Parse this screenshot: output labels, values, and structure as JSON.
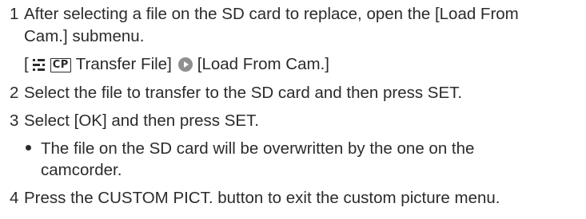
{
  "steps": [
    {
      "number": "1",
      "line1": "After selecting a file on the SD card to replace, open the [Load From",
      "line2": "Cam.] submenu.",
      "menu_path": {
        "open_bracket": "[",
        "menu_icon": "menu-lines-icon",
        "cp_label": "CP",
        "item": "Transfer File]",
        "arrow_icon": "right-arrow-circle-icon",
        "target": "[Load From Cam.]"
      }
    },
    {
      "number": "2",
      "text": "Select the file to transfer to the SD card and then press SET."
    },
    {
      "number": "3",
      "text": "Select [OK] and then press SET.",
      "bullet": {
        "line1": "The file on the SD card will be overwritten by the one on the",
        "line2": "camcorder."
      }
    },
    {
      "number": "4",
      "text": "Press the CUSTOM PICT. button to exit the custom picture menu."
    }
  ],
  "colors": {
    "text": "#2b2b2b",
    "arrow_icon": "#8f8f8f"
  }
}
